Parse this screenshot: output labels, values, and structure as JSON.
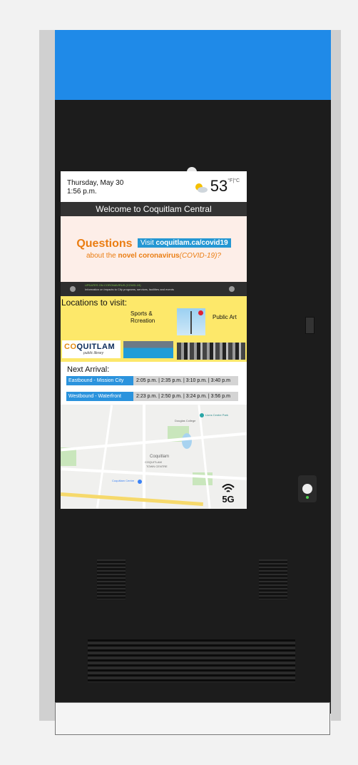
{
  "screen": {
    "date_line": "Thursday, May 30",
    "time_line": "1:56 p.m.",
    "weather": {
      "icon": "partly-sunny-icon",
      "temperature": "53",
      "unit": "°F|°C"
    },
    "welcome": "Welcome to Coquitlam Central",
    "covid_banner": {
      "questions": "Questions",
      "visit_prefix": "Visit ",
      "visit_url": "coquitlam.ca/covid19",
      "about_prefix": "about the ",
      "about_bold": "novel coronavirus",
      "about_italic": "(COVID-19)?"
    },
    "ticker": {
      "title": "UPDATES ON CORONAVIRUS (COVID-19)",
      "text": "Information on impacts to City programs, services, facilities and events"
    },
    "locations": {
      "title": "Locations to visit:",
      "sports_line1": "Sports &",
      "sports_line2": "Rcreation",
      "public_art": "Public Art",
      "library_logo_main_a": "CO",
      "library_logo_main_b": "QUITLAM",
      "library_logo_sub": "public library"
    },
    "next_arrival": {
      "title": "Next Arrival:",
      "routes": [
        {
          "name": "Eastbound - Mission City",
          "times": "2:05 p.m. | 2:35 p.m. | 3:10 p.m. | 3:40 p.m"
        },
        {
          "name": "Westbound - Waterfront",
          "times": "2:23 p.m. | 2:50 p.m. | 3:24 p.m. | 3:56 p.m"
        }
      ]
    },
    "map": {
      "labels": [
        "Douglas College",
        "Lions Centre Park",
        "Coquitlam",
        "COQUITLAM",
        "TOWN CENTRE",
        "Coquitlam Centre"
      ],
      "badge": "5G"
    }
  },
  "colors": {
    "cap_blue": "#1f8ae8",
    "route_blue": "#2b93dd",
    "banner_orange": "#ea7d12",
    "locations_yellow": "#fde86a"
  }
}
